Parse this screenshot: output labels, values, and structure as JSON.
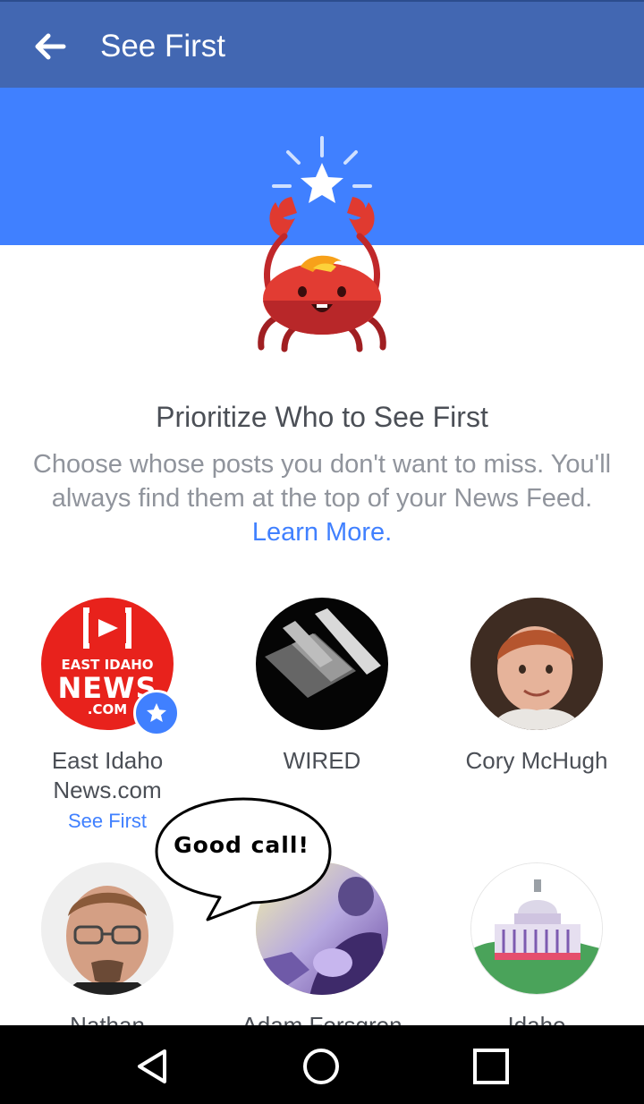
{
  "appbar": {
    "title": "See First",
    "back_icon": "arrow-left-icon"
  },
  "hero": {
    "mascot": "crab-star-illustration"
  },
  "intro": {
    "heading": "Prioritize Who to See First",
    "body": "Choose whose posts you don't want to miss. You'll always find them at the top of your News Feed.",
    "learn_more": "Learn More."
  },
  "profiles": [
    {
      "name": "East Idaho News.com",
      "selected": true,
      "status": "See First",
      "logo_line1": "EAST IDAHO",
      "logo_line2": "NEWS",
      "logo_line3": ".COM"
    },
    {
      "name": "WIRED",
      "selected": false
    },
    {
      "name": "Cory McHugh",
      "selected": false
    },
    {
      "name": "Nathan",
      "selected": false
    },
    {
      "name": "Adam Forsgren",
      "selected": false
    },
    {
      "name": "Idaho",
      "selected": false
    }
  ],
  "speech_bubble": {
    "text": "Good call!"
  },
  "navbar": {
    "back_icon": "triangle-back-icon",
    "home_icon": "circle-home-icon",
    "recents_icon": "square-recents-icon"
  },
  "colors": {
    "appbar": "#4267b2",
    "hero": "#4080ff",
    "accent": "#4080ff",
    "text": "#4b4f56",
    "muted": "#90949c"
  }
}
